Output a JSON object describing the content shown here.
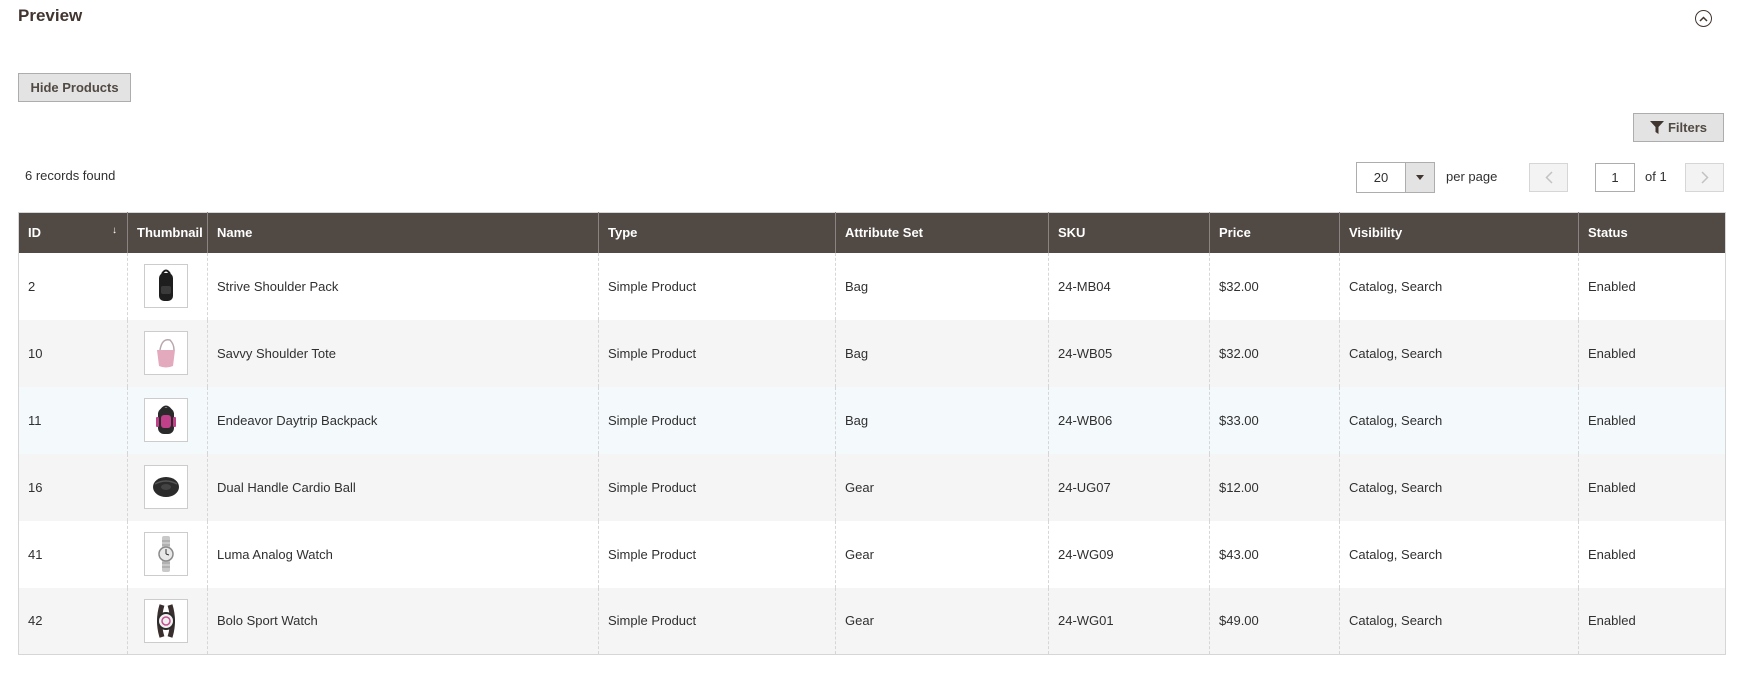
{
  "section": {
    "title": "Preview"
  },
  "toolbar": {
    "hide_products_label": "Hide Products",
    "filters_label": "Filters",
    "records_found": "6 records found",
    "per_page_value": "20",
    "per_page_label": "per page",
    "current_page": "1",
    "page_of": "of 1"
  },
  "columns": [
    {
      "label": "ID"
    },
    {
      "label": "Thumbnail"
    },
    {
      "label": "Name"
    },
    {
      "label": "Type"
    },
    {
      "label": "Attribute Set"
    },
    {
      "label": "SKU"
    },
    {
      "label": "Price"
    },
    {
      "label": "Visibility"
    },
    {
      "label": "Status"
    }
  ],
  "sort_indicator": "↓",
  "rows": [
    {
      "id": "2",
      "thumb": "backpack-black-icon",
      "name": "Strive Shoulder Pack",
      "type": "Simple Product",
      "attribute_set": "Bag",
      "sku": "24-MB04",
      "price": "$32.00",
      "visibility": "Catalog, Search",
      "status": "Enabled"
    },
    {
      "id": "10",
      "thumb": "tote-pink-icon",
      "name": "Savvy Shoulder Tote",
      "type": "Simple Product",
      "attribute_set": "Bag",
      "sku": "24-WB05",
      "price": "$32.00",
      "visibility": "Catalog, Search",
      "status": "Enabled"
    },
    {
      "id": "11",
      "thumb": "backpack-pink-icon",
      "name": "Endeavor Daytrip Backpack",
      "type": "Simple Product",
      "attribute_set": "Bag",
      "sku": "24-WB06",
      "price": "$33.00",
      "visibility": "Catalog, Search",
      "status": "Enabled"
    },
    {
      "id": "16",
      "thumb": "cardio-ball-icon",
      "name": "Dual Handle Cardio Ball",
      "type": "Simple Product",
      "attribute_set": "Gear",
      "sku": "24-UG07",
      "price": "$12.00",
      "visibility": "Catalog, Search",
      "status": "Enabled"
    },
    {
      "id": "41",
      "thumb": "watch-silver-icon",
      "name": "Luma Analog Watch",
      "type": "Simple Product",
      "attribute_set": "Gear",
      "sku": "24-WG09",
      "price": "$43.00",
      "visibility": "Catalog, Search",
      "status": "Enabled"
    },
    {
      "id": "42",
      "thumb": "watch-sport-icon",
      "name": "Bolo Sport Watch",
      "type": "Simple Product",
      "attribute_set": "Gear",
      "sku": "24-WG01",
      "price": "$49.00",
      "visibility": "Catalog, Search",
      "status": "Enabled"
    }
  ],
  "colors": {
    "header_bg": "#514943",
    "button_bg": "#e3e3e3",
    "row_alt": "#f5f5f5",
    "row_highlight": "#f4f9fc"
  }
}
